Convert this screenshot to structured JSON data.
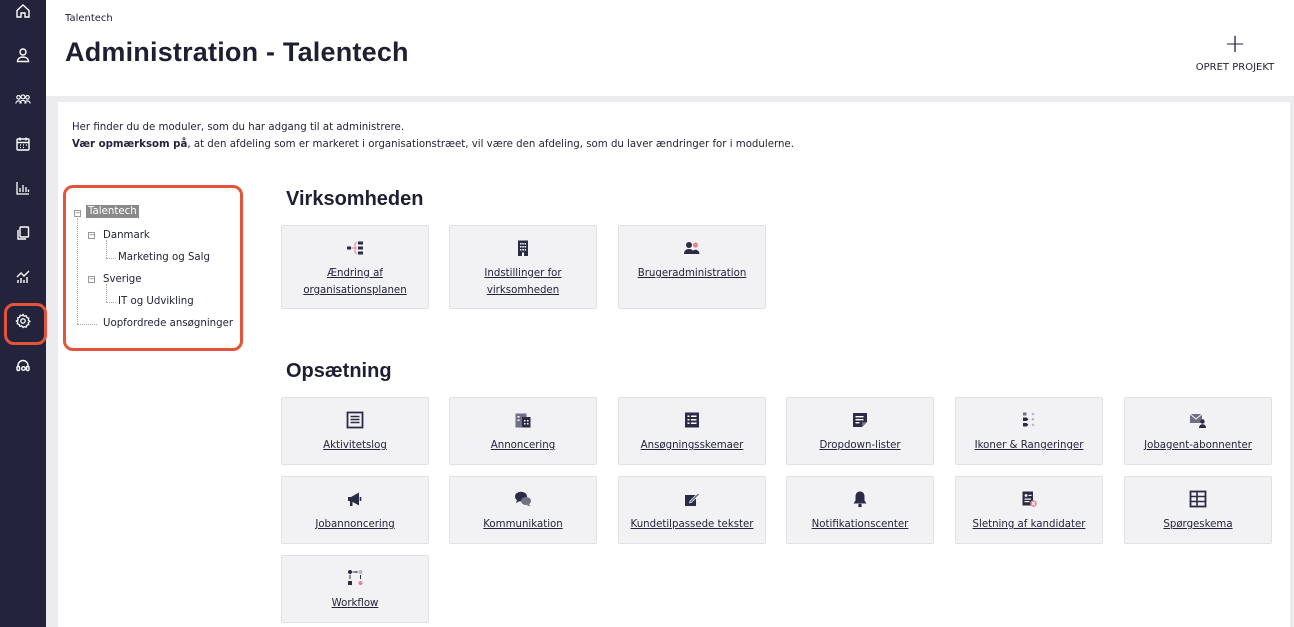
{
  "sidebar": {
    "items": [
      {
        "name": "home-icon",
        "active": false
      },
      {
        "name": "user-icon",
        "active": false
      },
      {
        "name": "users-group-icon",
        "active": false
      },
      {
        "name": "calendar-icon",
        "active": false
      },
      {
        "name": "bar-chart-icon",
        "active": false
      },
      {
        "name": "documents-icon",
        "active": false
      },
      {
        "name": "analytics-icon",
        "active": false
      },
      {
        "name": "gear-icon",
        "active": true
      },
      {
        "name": "headset-icon",
        "active": false
      }
    ]
  },
  "header": {
    "breadcrumb": "Talentech",
    "title": "Administration - Talentech",
    "create_symbol": "+",
    "create_label": "OPRET PROJEKT"
  },
  "intro": {
    "line1": "Her finder du de moduler, som du har adgang til at administrere.",
    "line2_bold": "Vær opmærksom på",
    "line2_rest": ", at den afdeling som er markeret i organisationstræet, vil være den afdeling, som du laver ændringer for i modulerne."
  },
  "tree": {
    "root": "Talentech",
    "children": [
      {
        "label": "Danmark",
        "children": [
          "Marketing og Salg"
        ]
      },
      {
        "label": "Sverige",
        "children": [
          "IT og Udvikling"
        ]
      },
      {
        "label": "Uopfordrede ansøgninger",
        "children": []
      }
    ]
  },
  "sections": {
    "virksomheden": {
      "title": "Virksomheden",
      "cards": [
        {
          "label": "Ændring af organisationsplanen",
          "icon": "org-chart-icon"
        },
        {
          "label": "Indstillinger for virksomheden",
          "icon": "building-icon"
        },
        {
          "label": "Brugeradministration",
          "icon": "user-admin-icon"
        }
      ]
    },
    "opsaetning": {
      "title": "Opsætning",
      "cards": [
        {
          "label": "Aktivitetslog",
          "icon": "list-icon"
        },
        {
          "label": "Annoncering",
          "icon": "advert-icon"
        },
        {
          "label": "Ansøgningsskemaer",
          "icon": "form-icon"
        },
        {
          "label": "Dropdown-lister",
          "icon": "dropdown-icon"
        },
        {
          "label": "Ikoner & Rangeringer",
          "icon": "ranking-icon"
        },
        {
          "label": "Jobagent-abonnenter",
          "icon": "mail-subscriber-icon"
        },
        {
          "label": "Jobannoncering",
          "icon": "megaphone-icon"
        },
        {
          "label": "Kommunikation",
          "icon": "chat-icon"
        },
        {
          "label": "Kundetilpassede tekster",
          "icon": "edit-icon"
        },
        {
          "label": "Notifikationscenter",
          "icon": "bell-icon"
        },
        {
          "label": "Sletning af kandidater",
          "icon": "delete-candidate-icon"
        },
        {
          "label": "Spørgeskema",
          "icon": "questionnaire-icon"
        },
        {
          "label": "Workflow",
          "icon": "workflow-icon"
        }
      ]
    }
  },
  "colors": {
    "sidebar": "#23233c",
    "accent_highlight": "#e4543a",
    "card_bg": "#f2f2f4",
    "icon_primary": "#2b2b45",
    "icon_accent": "#e8848c"
  }
}
